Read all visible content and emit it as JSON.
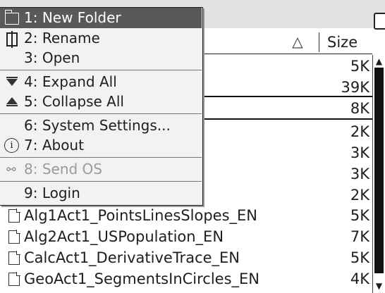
{
  "browser": {
    "size_header": "Size",
    "sort_indicator": "△",
    "rows": [
      {
        "name": "",
        "size": "5K"
      },
      {
        "name": "",
        "size": "39K"
      },
      {
        "name": "",
        "size": "8K"
      },
      {
        "name": "",
        "size": "2K"
      },
      {
        "name": "",
        "size": "3K"
      },
      {
        "name": "",
        "size": "3K"
      },
      {
        "name": "",
        "size": "2K"
      },
      {
        "name": "Alg1Act1_PointsLinesSlopes_EN",
        "size": "5K"
      },
      {
        "name": "Alg2Act1_USPopulation_EN",
        "size": "7K"
      },
      {
        "name": "CalcAct1_DerivativeTrace_EN",
        "size": "5K"
      },
      {
        "name": "GeoAct1_SegmentsInCircles_EN",
        "size": "4K"
      }
    ]
  },
  "menu": {
    "items": [
      {
        "label": "1: New Folder",
        "icon": "new-folder-icon",
        "state": "highlighted"
      },
      {
        "label": "2: Rename",
        "icon": "rename-icon",
        "state": "enabled"
      },
      {
        "label": "3: Open",
        "icon": "",
        "state": "enabled"
      },
      {
        "label": "4: Expand All",
        "icon": "expand-all-icon",
        "state": "enabled"
      },
      {
        "label": "5: Collapse All",
        "icon": "collapse-all-icon",
        "state": "enabled"
      },
      {
        "label": "6: System Settings...",
        "icon": "",
        "state": "enabled"
      },
      {
        "label": "7: About",
        "icon": "info-icon",
        "state": "enabled"
      },
      {
        "label": "8: Send OS",
        "icon": "send-os-icon",
        "state": "disabled"
      },
      {
        "label": "9: Login",
        "icon": "",
        "state": "enabled"
      }
    ]
  },
  "colors": {
    "highlight": "#595959",
    "menu_bg": "#f2f2f2",
    "disabled_text": "#9a9a9a"
  }
}
